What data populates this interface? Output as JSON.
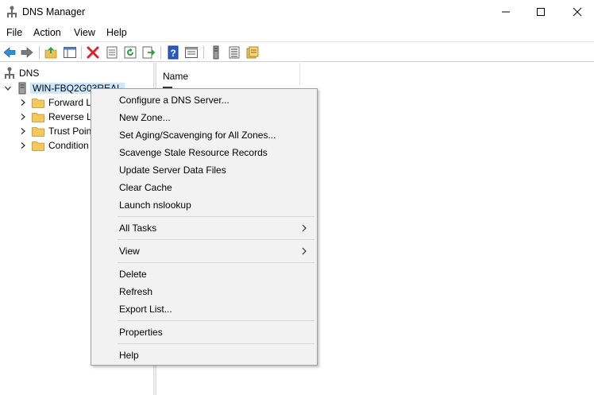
{
  "window": {
    "title": "DNS Manager"
  },
  "menu": {
    "file": "File",
    "action": "Action",
    "view": "View",
    "help": "Help"
  },
  "toolbar": {
    "icons": [
      "back-arrow-icon",
      "forward-arrow-icon",
      "up-folder-icon",
      "show-hide-tree-icon",
      "delete-icon",
      "properties-icon",
      "refresh-icon",
      "export-icon",
      "help-icon",
      "console-tree-icon",
      "server-icon",
      "list-icon",
      "zone-icon"
    ]
  },
  "tree": {
    "root": "DNS",
    "server": "WIN-FBQ2G03REAL",
    "children": [
      {
        "label": "Forward L"
      },
      {
        "label": "Reverse Lo"
      },
      {
        "label": "Trust Poin"
      },
      {
        "label": "Condition"
      }
    ]
  },
  "list": {
    "column_name": "Name"
  },
  "context_menu": {
    "group1": [
      "Configure a DNS Server...",
      "New Zone...",
      "Set Aging/Scavenging for All Zones...",
      "Scavenge Stale Resource Records",
      "Update Server Data Files",
      "Clear Cache",
      "Launch nslookup"
    ],
    "all_tasks": "All Tasks",
    "view": "View",
    "group3": [
      "Delete",
      "Refresh",
      "Export List..."
    ],
    "properties": "Properties",
    "help": "Help"
  },
  "colors": {
    "selection": "#cce8ff",
    "menu_bg": "#f2f2f2",
    "folder": "#f4c85a"
  }
}
